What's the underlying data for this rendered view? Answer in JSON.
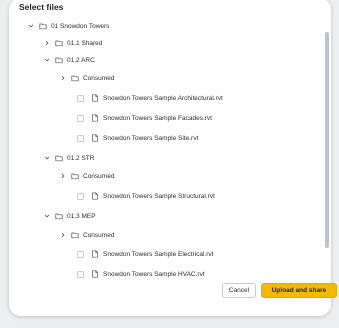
{
  "dialog": {
    "title": "Select files",
    "buttons": {
      "cancel": "Cancel",
      "confirm": "Upload and share"
    },
    "accent_color": "#f5b800"
  },
  "tree": {
    "root": "01 Snowdon Towers",
    "shared": "01.1 Shared",
    "arc": "01.2 ARC",
    "arc_consumed": "Consumed",
    "arc_files": [
      "Snowdon Towers Sample Architectural.rvt",
      "Snowdon Towers Sample Facades.rvt",
      "Snowdon Towers Sample Site.rvt"
    ],
    "str": "01.2 STR",
    "str_consumed": "Consumed",
    "str_files": [
      "Snowdon Towers Sample Structural.rvt"
    ],
    "mep": "01.3 MEP",
    "mep_consumed": "Consumed",
    "mep_files": [
      "Snowdon Towers Sample Electrical.rvt",
      "Snowdon Towers Sample HVAC.rvt"
    ]
  }
}
